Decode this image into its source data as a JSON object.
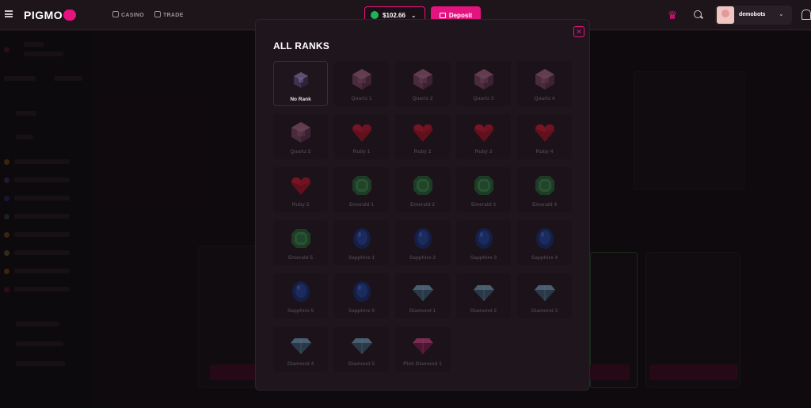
{
  "brand": {
    "name": "PIGMO"
  },
  "nav": {
    "casino": "CASINO",
    "trade": "TRADE"
  },
  "wallet": {
    "balance": "$102.66"
  },
  "deposit": {
    "label": "Deposit"
  },
  "user": {
    "name": "demobots"
  },
  "modal": {
    "title": "ALL RANKS",
    "close_icon": "close-icon",
    "ranks": [
      {
        "label": "No Rank",
        "gem": "cube-dark",
        "selected": true
      },
      {
        "label": "Quartz 1",
        "gem": "quartz"
      },
      {
        "label": "Quartz 2",
        "gem": "quartz"
      },
      {
        "label": "Quartz 3",
        "gem": "quartz"
      },
      {
        "label": "Quartz 4",
        "gem": "quartz"
      },
      {
        "label": "Quartz 5",
        "gem": "quartz"
      },
      {
        "label": "Ruby 1",
        "gem": "ruby"
      },
      {
        "label": "Ruby 2",
        "gem": "ruby"
      },
      {
        "label": "Ruby 3",
        "gem": "ruby"
      },
      {
        "label": "Ruby 4",
        "gem": "ruby"
      },
      {
        "label": "Ruby 5",
        "gem": "ruby"
      },
      {
        "label": "Emerald 1",
        "gem": "emerald"
      },
      {
        "label": "Emerald 2",
        "gem": "emerald"
      },
      {
        "label": "Emerald 3",
        "gem": "emerald"
      },
      {
        "label": "Emerald 4",
        "gem": "emerald"
      },
      {
        "label": "Emerald 5",
        "gem": "emerald"
      },
      {
        "label": "Sapphire 1",
        "gem": "sapphire"
      },
      {
        "label": "Sapphire 2",
        "gem": "sapphire"
      },
      {
        "label": "Sapphire 3",
        "gem": "sapphire"
      },
      {
        "label": "Sapphire 4",
        "gem": "sapphire"
      },
      {
        "label": "Sapphire 5",
        "gem": "sapphire"
      },
      {
        "label": "Sapphire 6",
        "gem": "sapphire"
      },
      {
        "label": "Diamond 1",
        "gem": "diamond"
      },
      {
        "label": "Diamond 2",
        "gem": "diamond"
      },
      {
        "label": "Diamond 3",
        "gem": "diamond"
      },
      {
        "label": "Diamond 4",
        "gem": "diamond"
      },
      {
        "label": "Diamond 5",
        "gem": "diamond"
      },
      {
        "label": "Pink Diamond 1",
        "gem": "pink-diamond"
      }
    ]
  },
  "colors": {
    "accent": "#e5137f",
    "wallet_coin": "#21b35a",
    "background": "#1a1117"
  }
}
